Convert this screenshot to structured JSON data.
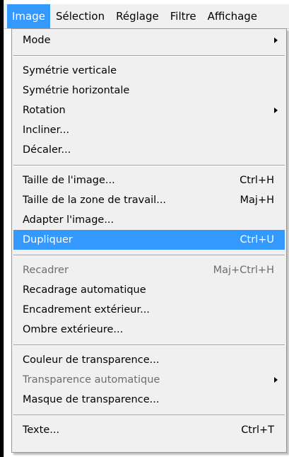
{
  "menubar": {
    "items": [
      {
        "label": "Image",
        "active": true
      },
      {
        "label": "Sélection"
      },
      {
        "label": "Réglage"
      },
      {
        "label": "Filtre"
      },
      {
        "label": "Affichage"
      }
    ]
  },
  "menu": {
    "mode": {
      "label": "Mode"
    },
    "symetrie_verticale": {
      "label": "Symétrie verticale"
    },
    "symetrie_horizontale": {
      "label": "Symétrie horizontale"
    },
    "rotation": {
      "label": "Rotation"
    },
    "incliner": {
      "label": "Incliner..."
    },
    "decaler": {
      "label": "Décaler..."
    },
    "taille_image": {
      "label": "Taille de l'image...",
      "shortcut": "Ctrl+H"
    },
    "taille_zone": {
      "label": "Taille de la zone de travail...",
      "shortcut": "Maj+H"
    },
    "adapter_image": {
      "label": "Adapter l'image..."
    },
    "dupliquer": {
      "label": "Dupliquer",
      "shortcut": "Ctrl+U"
    },
    "recadrer": {
      "label": "Recadrer",
      "shortcut": "Maj+Ctrl+H"
    },
    "recadrage_auto": {
      "label": "Recadrage automatique"
    },
    "encadrement_ext": {
      "label": "Encadrement extérieur..."
    },
    "ombre_ext": {
      "label": "Ombre extérieure..."
    },
    "couleur_transp": {
      "label": "Couleur de transparence..."
    },
    "transp_auto": {
      "label": "Transparence automatique"
    },
    "masque_transp": {
      "label": "Masque de transparence..."
    },
    "texte": {
      "label": "Texte...",
      "shortcut": "Ctrl+T"
    }
  },
  "colors": {
    "highlight": "#3399ff",
    "menu_background": "#f0f0f0",
    "disabled_text": "#6d6d6d"
  },
  "icons": {
    "submenu_arrow": "submenu-arrow-icon"
  }
}
